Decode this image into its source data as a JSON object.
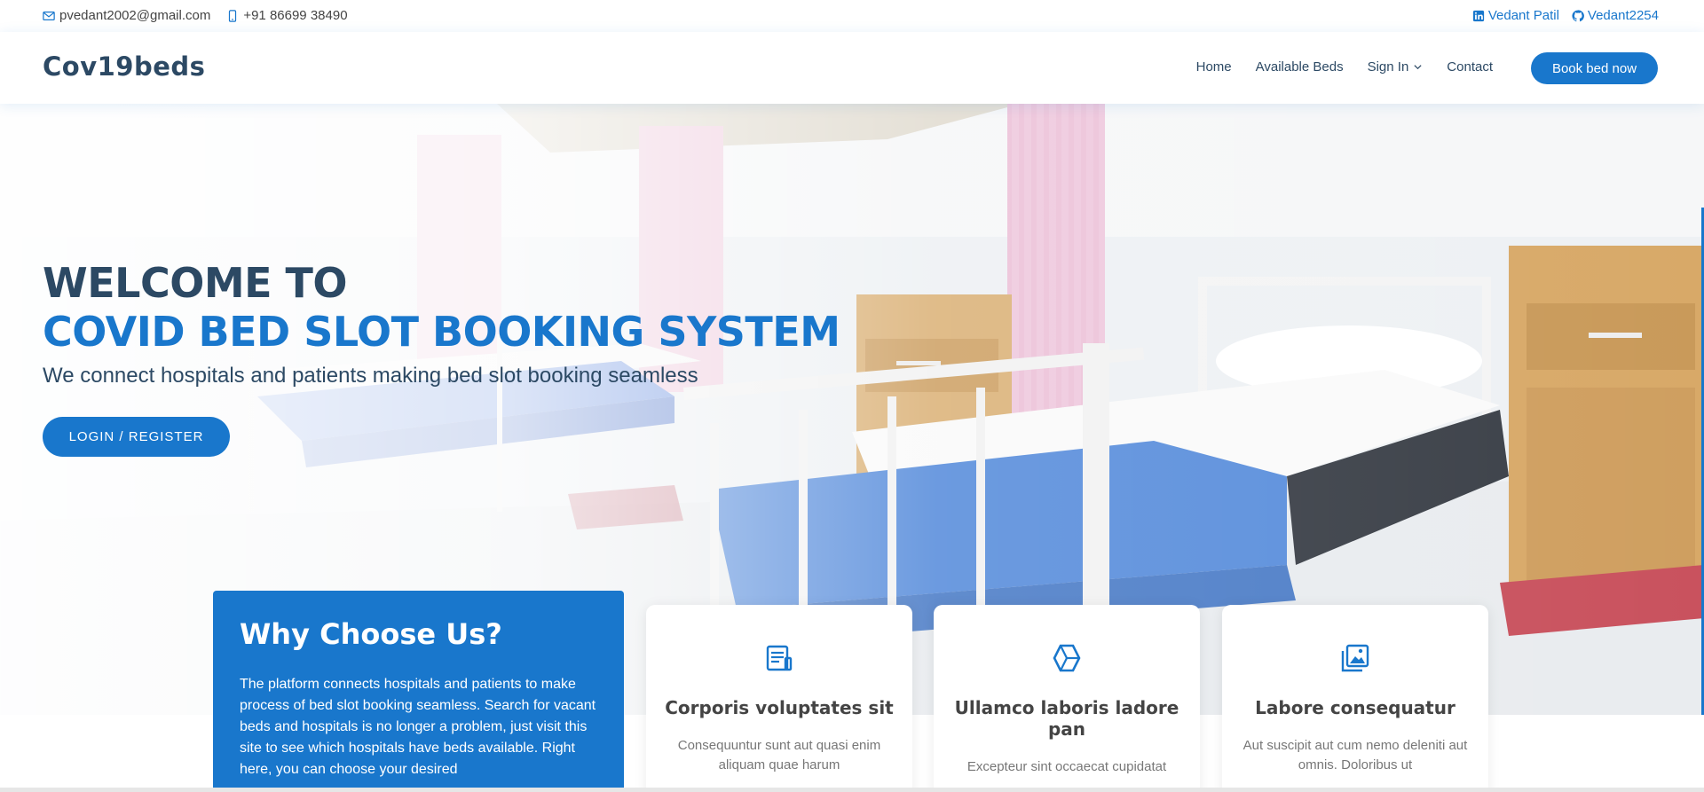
{
  "topbar": {
    "email": "pvedant2002@gmail.com",
    "phone": "+91 86699 38490",
    "linkedin": "Vedant Patil",
    "github": "Vedant2254"
  },
  "header": {
    "logo": "Cov19beds",
    "nav": {
      "home": "Home",
      "available_beds": "Available Beds",
      "sign_in": "Sign In",
      "contact": "Contact"
    },
    "cta": "Book bed now"
  },
  "hero": {
    "title_line1": "WELCOME TO",
    "title_line2": "COVID BED SLOT BOOKING SYSTEM",
    "subtitle": "We connect hospitals and patients making bed slot booking seamless",
    "button": "LOGIN / REGISTER"
  },
  "why": {
    "title": "Why Choose Us?",
    "text": "The platform connects hospitals and patients to make process of bed slot booking seamless. Search for vacant beds and hospitals is no longer a problem, just visit this site to see which hospitals have beds available. Right here, you can choose your desired"
  },
  "features": [
    {
      "icon": "receipt-icon",
      "title": "Corporis voluptates sit",
      "text": "Consequuntur sunt aut quasi enim aliquam quae harum"
    },
    {
      "icon": "cube-alt-icon",
      "title": "Ullamco laboris ladore pan",
      "text": "Excepteur sint occaecat cupidatat"
    },
    {
      "icon": "images-icon",
      "title": "Labore consequatur",
      "text": "Aut suscipit aut cum nemo deleniti aut omnis. Doloribus ut"
    }
  ],
  "colors": {
    "accent": "#1977cc",
    "dark": "#2c4964"
  }
}
